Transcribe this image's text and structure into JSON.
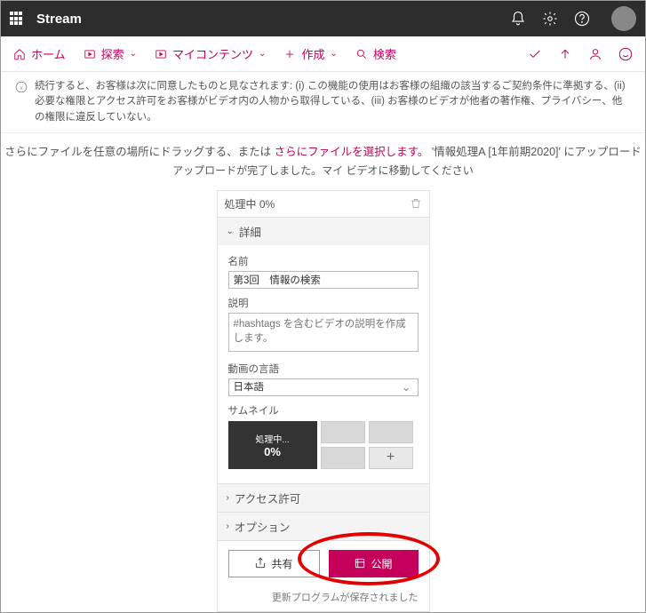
{
  "header": {
    "brand": "Stream"
  },
  "nav": {
    "home": "ホーム",
    "explore": "探索",
    "mycontent": "マイコンテンツ",
    "create": "作成",
    "search": "検索"
  },
  "notice": {
    "text": "続行すると、お客様は次に同意したものと見なされます: (i) この機能の使用はお客様の組織の該当するご契約条件に準拠する、(ii) 必要な権限とアクセス許可をお客様がビデオ内の人物から取得している、(iii) お客様のビデオが他者の著作権、プライバシー、他の権限に違反していない。"
  },
  "msg": {
    "part1": "さらにファイルを任意の場所にドラッグする、または ",
    "link": "さらにファイルを選択します。",
    "part2": " '情報処理A [1年前期2020]' にアップロード",
    "line2a": "アップロードが完了しました。",
    "line2b": "マイ ビデオ",
    "line2c": "に移動してください"
  },
  "panel": {
    "progress": "処理中 0%",
    "details": "詳細",
    "name_label": "名前",
    "name_value": "第3回　情報の検索",
    "desc_label": "説明",
    "desc_placeholder": "#hashtags を含むビデオの説明を作成します。",
    "lang_label": "動画の言語",
    "lang_value": "日本語",
    "thumb_label": "サムネイル",
    "thumb_processing": "処理中...",
    "thumb_pct": "0%",
    "access": "アクセス許可",
    "options": "オプション",
    "share": "共有",
    "publish": "公開",
    "footnote": "更新プログラムが保存されました"
  }
}
